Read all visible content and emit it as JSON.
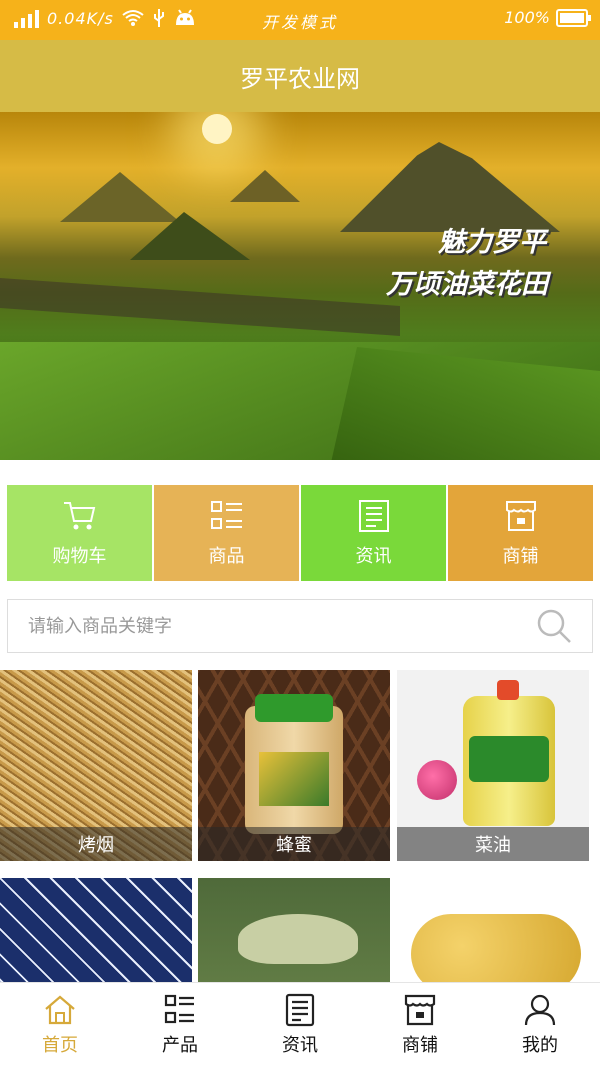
{
  "status_bar": {
    "speed": "0.04K/s",
    "center_text": "开发模式",
    "battery": "100%"
  },
  "title_bar": {
    "title": "罗平农业网"
  },
  "banner": {
    "caption_line1": "魅力罗平",
    "caption_line2": "万顷油菜花田"
  },
  "quick_menu": [
    {
      "label": "购物车",
      "icon": "cart-icon",
      "color": "#a6e465"
    },
    {
      "label": "商品",
      "icon": "list-icon",
      "color": "#e6b356"
    },
    {
      "label": "资讯",
      "icon": "news-icon",
      "color": "#7ad93a"
    },
    {
      "label": "商铺",
      "icon": "shop-icon",
      "color": "#e3a53a"
    }
  ],
  "search": {
    "placeholder": "请输入商品关键字"
  },
  "products": [
    {
      "label": "烤烟"
    },
    {
      "label": "蜂蜜"
    },
    {
      "label": "菜油"
    },
    {
      "label": ""
    },
    {
      "label": ""
    },
    {
      "label": ""
    }
  ],
  "bottom_nav": [
    {
      "label": "首页",
      "icon": "home-icon",
      "active": true
    },
    {
      "label": "产品",
      "icon": "list-icon"
    },
    {
      "label": "资讯",
      "icon": "news-icon"
    },
    {
      "label": "商铺",
      "icon": "shop-icon"
    },
    {
      "label": "我的",
      "icon": "user-icon"
    }
  ],
  "colors": {
    "status_bar": "#f6b21a",
    "title_bar": "#d6bb46",
    "active_nav": "#d6a93a"
  }
}
